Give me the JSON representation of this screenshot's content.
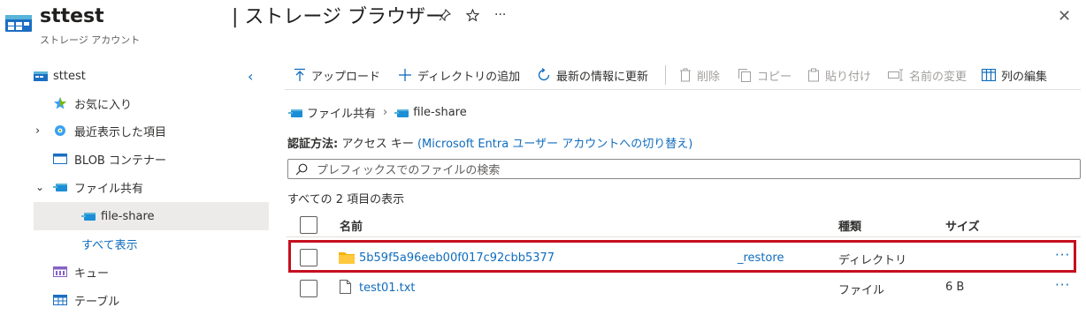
{
  "header": {
    "resource_name": "sttest",
    "resource_type": "ストレージ アカウント",
    "blade_title": "| ストレージ ブラウザー",
    "ellipsis": "···"
  },
  "sidebar": {
    "items": [
      {
        "label": "sttest"
      },
      {
        "label": "お気に入り"
      },
      {
        "label": "最近表示した項目"
      },
      {
        "label": "BLOB コンテナー"
      },
      {
        "label": "ファイル共有"
      },
      {
        "label": "file-share"
      },
      {
        "label": "すべて表示"
      },
      {
        "label": "キュー"
      },
      {
        "label": "テーブル"
      }
    ]
  },
  "toolbar": {
    "upload": "アップロード",
    "add_directory": "ディレクトリの追加",
    "refresh": "最新の情報に更新",
    "delete": "削除",
    "copy": "コピー",
    "paste": "貼り付け",
    "rename": "名前の変更",
    "edit_columns": "列の編集"
  },
  "breadcrumb": {
    "root": "ファイル共有",
    "current": "file-share"
  },
  "auth": {
    "label": "認証方法:",
    "value": "アクセス キー",
    "switch_link": "(Microsoft Entra ユーザー アカウントへの切り替え)"
  },
  "search": {
    "placeholder": "プレフィックスでのファイルの検索"
  },
  "list": {
    "count_text": "すべての 2 項目の表示",
    "columns": {
      "name": "名前",
      "type": "種類",
      "size": "サイズ"
    },
    "rows": [
      {
        "name": "5b59f5a96eeb00f017c92cbb5377",
        "extra": "_restore",
        "type": "ディレクトリ",
        "size": "",
        "more": "···"
      },
      {
        "name": "test01.txt",
        "extra": "",
        "type": "ファイル",
        "size": "6 B",
        "more": "···"
      }
    ]
  },
  "colors": {
    "accent": "#0f6cbd",
    "highlight": "#c50f1f",
    "folder": "#f0b400"
  }
}
